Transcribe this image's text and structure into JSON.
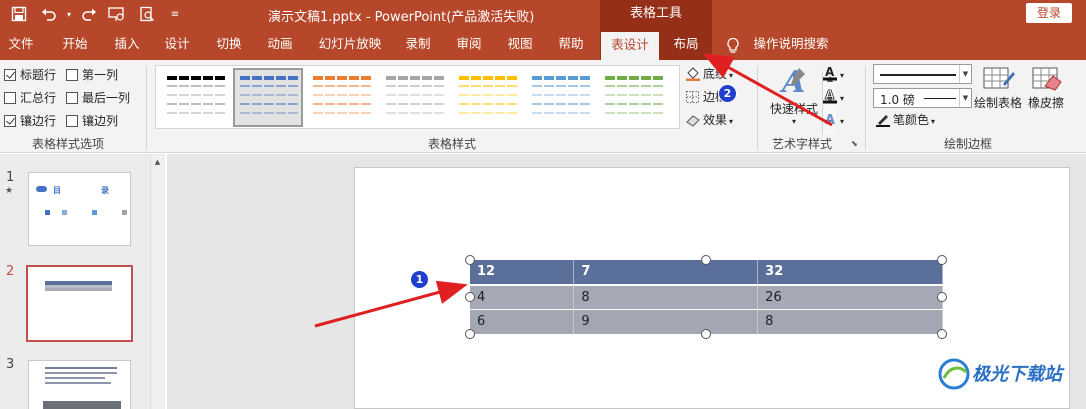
{
  "window": {
    "doc_title": "演示文稿1.pptx  -  PowerPoint(产品激活失败)",
    "context_group": "表格工具",
    "login": "登录"
  },
  "tabs": [
    {
      "label": "文件"
    },
    {
      "label": "开始"
    },
    {
      "label": "插入"
    },
    {
      "label": "设计"
    },
    {
      "label": "切换"
    },
    {
      "label": "动画"
    },
    {
      "label": "幻灯片放映"
    },
    {
      "label": "录制"
    },
    {
      "label": "审阅"
    },
    {
      "label": "视图"
    },
    {
      "label": "帮助"
    },
    {
      "label": "表设计",
      "active": true
    },
    {
      "label": "布局"
    }
  ],
  "tell_me": "操作说明搜索",
  "ribbon": {
    "style_options": {
      "label": "表格样式选项",
      "items": [
        {
          "label": "标题行",
          "checked": true
        },
        {
          "label": "汇总行",
          "checked": false
        },
        {
          "label": "镶边行",
          "checked": true
        },
        {
          "label": "第一列",
          "checked": false
        },
        {
          "label": "最后一列",
          "checked": false
        },
        {
          "label": "镶边列",
          "checked": false
        }
      ]
    },
    "table_styles": {
      "label": "表格样式",
      "swatches": [
        "#000000",
        "#4472c4",
        "#ed7d31",
        "#a5a5a5",
        "#ffc000",
        "#5b9bd5",
        "#70ad47"
      ],
      "selected_index": 1,
      "shading": "底纹",
      "borders": "边框",
      "effects": "效果"
    },
    "wordart": {
      "label": "艺术字样式",
      "quick_styles": "快速样式"
    },
    "draw_borders": {
      "label": "绘制边框",
      "pen_weight": "1.0 磅",
      "pen_color": "笔颜色",
      "draw_table": "绘制表格",
      "eraser": "橡皮擦"
    }
  },
  "slides": [
    {
      "number": "1",
      "star": "★",
      "heading_left": "目",
      "heading_right": "录"
    },
    {
      "number": "2"
    },
    {
      "number": "3"
    }
  ],
  "table": {
    "rows": [
      [
        "12",
        "7",
        "32"
      ],
      [
        "4",
        "8",
        "26"
      ],
      [
        "6",
        "9",
        "8"
      ]
    ]
  },
  "annotations": {
    "badge1": "1",
    "badge2": "2"
  },
  "watermark": "极光下载站",
  "colors": {
    "accent": "#b7472a",
    "context_tab": "#952f17",
    "table_header": "#5a6f9a",
    "table_body": "#a5a9b5",
    "arrow": "#e02020"
  }
}
